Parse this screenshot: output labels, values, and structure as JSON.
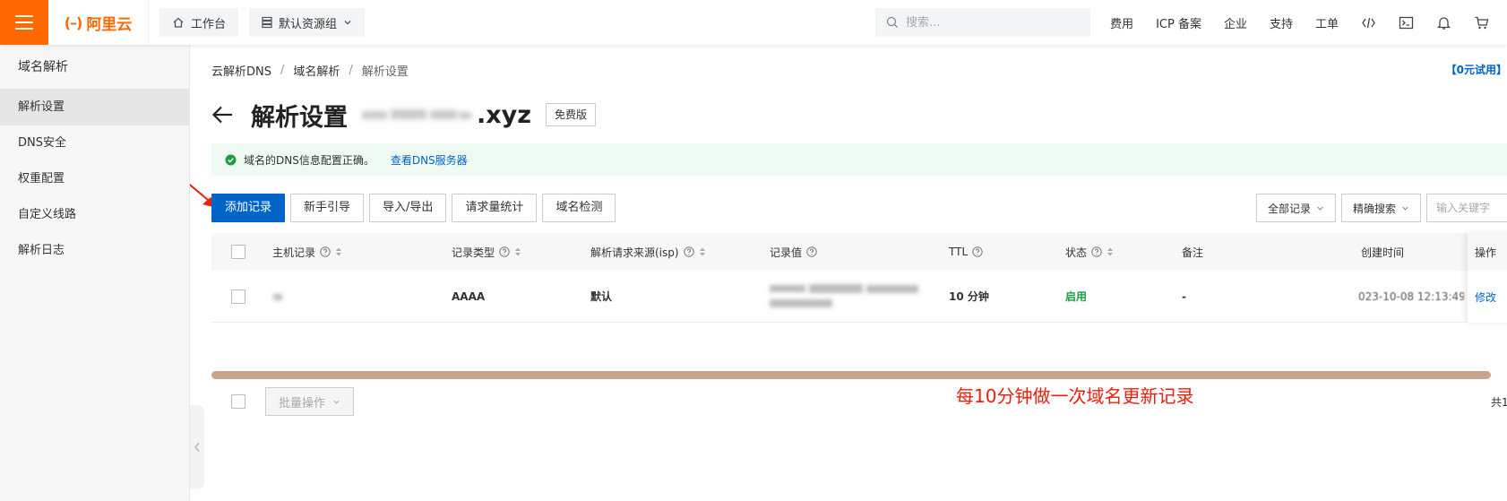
{
  "topbar": {
    "logo_text": "阿里云",
    "workbench_label": "工作台",
    "resource_group_label": "默认资源组",
    "search_placeholder": "搜索...",
    "nav": [
      "费用",
      "ICP 备案",
      "企业",
      "支持",
      "工单"
    ],
    "icons": [
      "code-icon",
      "terminal-icon",
      "bell-icon",
      "cart-icon"
    ]
  },
  "sidebar": {
    "title": "域名解析",
    "items": [
      {
        "label": "解析设置",
        "active": true
      },
      {
        "label": "DNS安全"
      },
      {
        "label": "权重配置"
      },
      {
        "label": "自定义线路"
      },
      {
        "label": "解析日志"
      }
    ]
  },
  "breadcrumb": [
    "云解析DNS",
    "域名解析",
    "解析设置"
  ],
  "trial_link": "【0元试用】",
  "header": {
    "title": "解析设置",
    "domain_suffix": ".xyz",
    "edition": "免费版"
  },
  "alert": {
    "message": "域名的DNS信息配置正确。",
    "link": "查看DNS服务器"
  },
  "toolbar": {
    "add_record": "添加记录",
    "guide": "新手引导",
    "import_export": "导入/导出",
    "request_stats": "请求量统计",
    "domain_check": "域名检测",
    "all_records": "全部记录",
    "exact_search": "精确搜索",
    "keyword_placeholder": "输入关键字"
  },
  "table": {
    "columns": {
      "host": "主机记录",
      "type": "记录类型",
      "isp": "解析请求来源(isp)",
      "value": "记录值",
      "ttl": "TTL",
      "status": "状态",
      "remark": "备注",
      "created": "创建时间",
      "actions": "操作"
    },
    "rows": [
      {
        "host": "",
        "type": "AAAA",
        "isp": "默认",
        "value": "",
        "ttl": "10 分钟",
        "status": "启用",
        "remark": "-",
        "created": "023-10-08 12:13:49",
        "action": "修改"
      }
    ]
  },
  "batch_label": "批量操作",
  "annotation": "每10分钟做一次域名更新记录",
  "total_label": "共1"
}
